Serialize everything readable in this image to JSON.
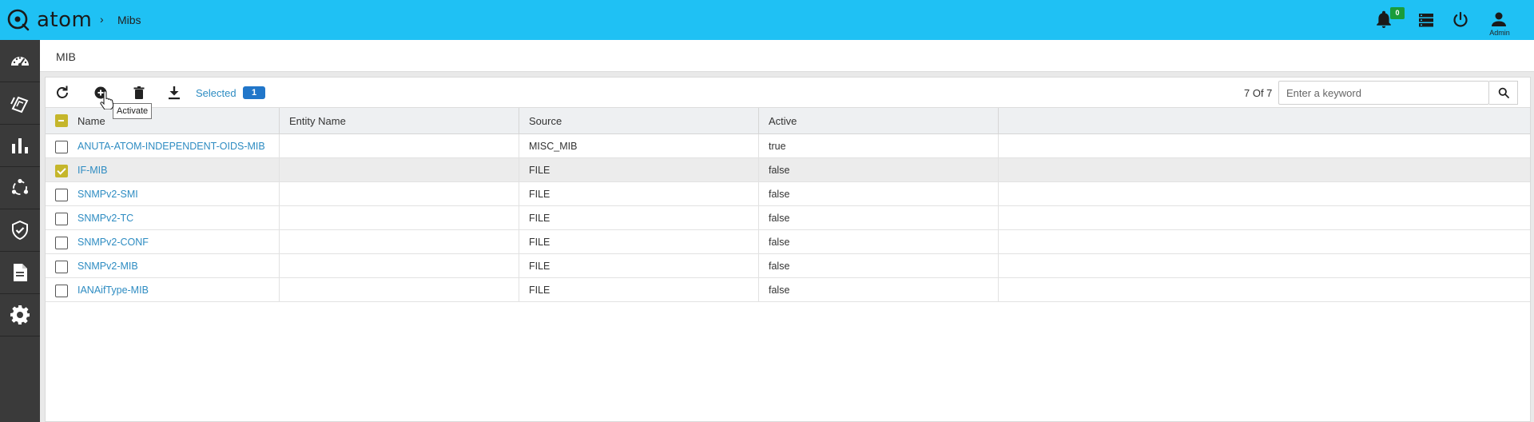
{
  "app": {
    "logo_text": "atom",
    "breadcrumb": "Mibs"
  },
  "topbar": {
    "notifications_count": "0",
    "user_label": "Admin"
  },
  "sidebar": {
    "items": [
      {
        "icon": "dashboard-icon"
      },
      {
        "icon": "devices-icon"
      },
      {
        "icon": "analytics-icon"
      },
      {
        "icon": "topology-icon"
      },
      {
        "icon": "compliance-icon"
      },
      {
        "icon": "document-icon"
      },
      {
        "icon": "settings-icon"
      }
    ]
  },
  "page": {
    "title": "MIB"
  },
  "toolbar": {
    "selected_label": "Selected",
    "selected_count": "1",
    "tooltip": "Activate",
    "count_text": "7 Of 7",
    "search_placeholder": "Enter a keyword"
  },
  "table": {
    "columns": [
      "Name",
      "Entity Name",
      "Source",
      "Active"
    ],
    "rows": [
      {
        "name": "ANUTA-ATOM-INDEPENDENT-OIDS-MIB",
        "entity": "",
        "source": "MISC_MIB",
        "active": "true",
        "checked": false
      },
      {
        "name": "IF-MIB",
        "entity": "",
        "source": "FILE",
        "active": "false",
        "checked": true
      },
      {
        "name": "SNMPv2-SMI",
        "entity": "",
        "source": "FILE",
        "active": "false",
        "checked": false
      },
      {
        "name": "SNMPv2-TC",
        "entity": "",
        "source": "FILE",
        "active": "false",
        "checked": false
      },
      {
        "name": "SNMPv2-CONF",
        "entity": "",
        "source": "FILE",
        "active": "false",
        "checked": false
      },
      {
        "name": "SNMPv2-MIB",
        "entity": "",
        "source": "FILE",
        "active": "false",
        "checked": false
      },
      {
        "name": "IANAifType-MIB",
        "entity": "",
        "source": "FILE",
        "active": "false",
        "checked": false
      }
    ]
  },
  "colors": {
    "topbar": "#1fc1f4",
    "sidebar": "#3a3a3a",
    "link": "#2e8cc2",
    "checkbox": "#c5b62b",
    "badge": "#1a9c3a"
  }
}
